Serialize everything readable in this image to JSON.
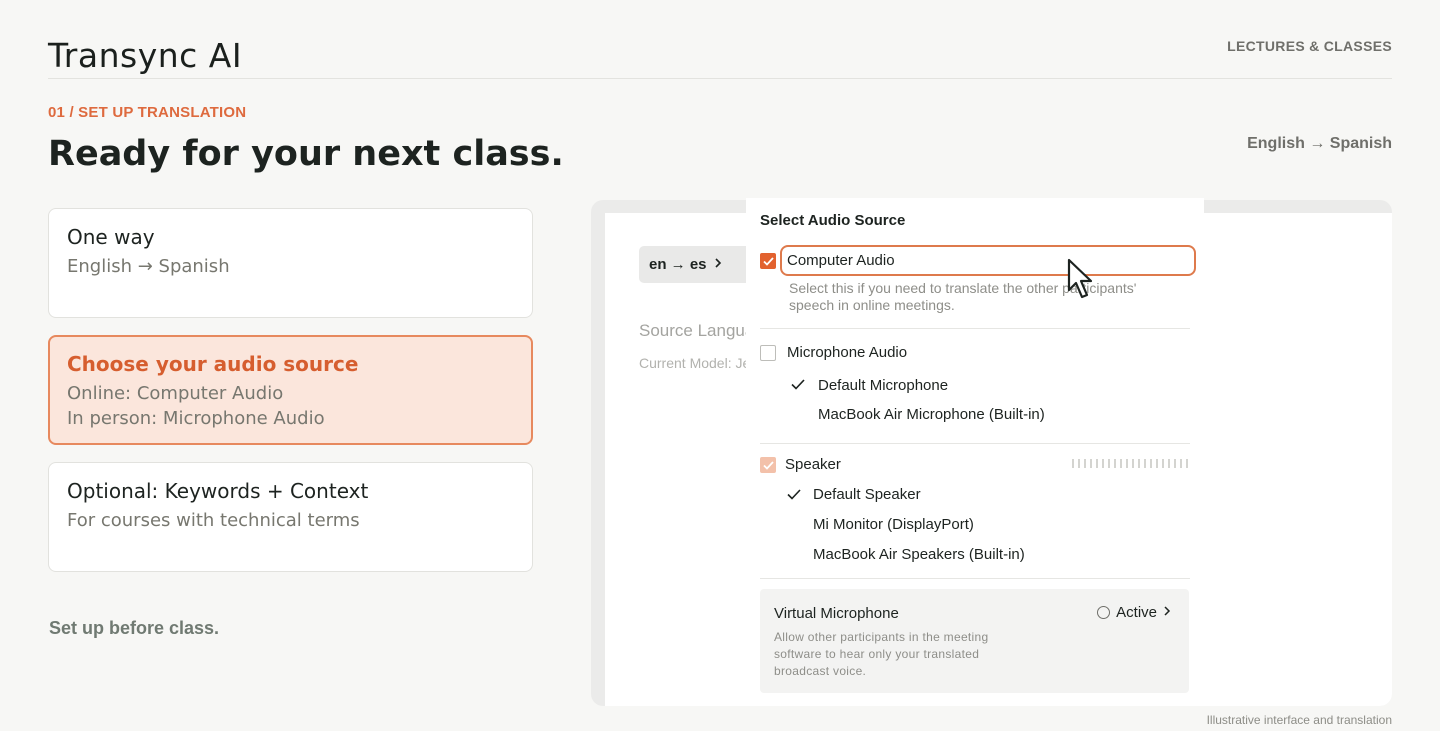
{
  "header": {
    "brand": "Transync AI",
    "section_label": "LECTURES & CLASSES"
  },
  "hero": {
    "step": "01 / SET UP TRANSLATION",
    "headline": "Ready for your next class.",
    "language_pair": "English → Spanish"
  },
  "cards": [
    {
      "title": "One way",
      "lines": [
        "English → Spanish"
      ]
    },
    {
      "title": "Choose your audio source",
      "lines": [
        "Online: Computer Audio",
        "In person: Microphone Audio"
      ]
    },
    {
      "title": "Optional: Keywords + Context",
      "lines": [
        "For courses with technical terms"
      ]
    }
  ],
  "footer_note": "Set up before class.",
  "caption": "Illustrative interface and translation",
  "app": {
    "lang_chip": "en → es",
    "source_language_label": "Source Language",
    "current_model_label": "Current Model: Je",
    "audio_panel": {
      "title": "Select Audio Source",
      "computer_audio": {
        "label": "Computer Audio",
        "checked": true,
        "help_line1": "Select this if you need to translate the other participants'",
        "help_line2": "speech in online meetings."
      },
      "microphone_audio": {
        "label": "Microphone Audio",
        "checked": false,
        "devices": [
          "Default Microphone",
          "MacBook Air Microphone (Built-in)"
        ],
        "selected_device": "Default Microphone"
      },
      "speaker": {
        "label": "Speaker",
        "checked": true,
        "devices": [
          "Default Speaker",
          "Mi Monitor (DisplayPort)",
          "MacBook Air Speakers (Built-in)"
        ],
        "selected_device": "Default Speaker"
      },
      "virtual_microphone": {
        "title": "Virtual Microphone",
        "status": "Active",
        "desc_line1": "Allow other participants in the meeting",
        "desc_line2": "software to hear only your translated",
        "desc_line3": "broadcast voice."
      }
    }
  },
  "colors": {
    "accent": "#e2622f",
    "accent_soft_bg": "#fbe6dc",
    "text_dark": "#1d2320",
    "text_muted": "#77776f"
  }
}
